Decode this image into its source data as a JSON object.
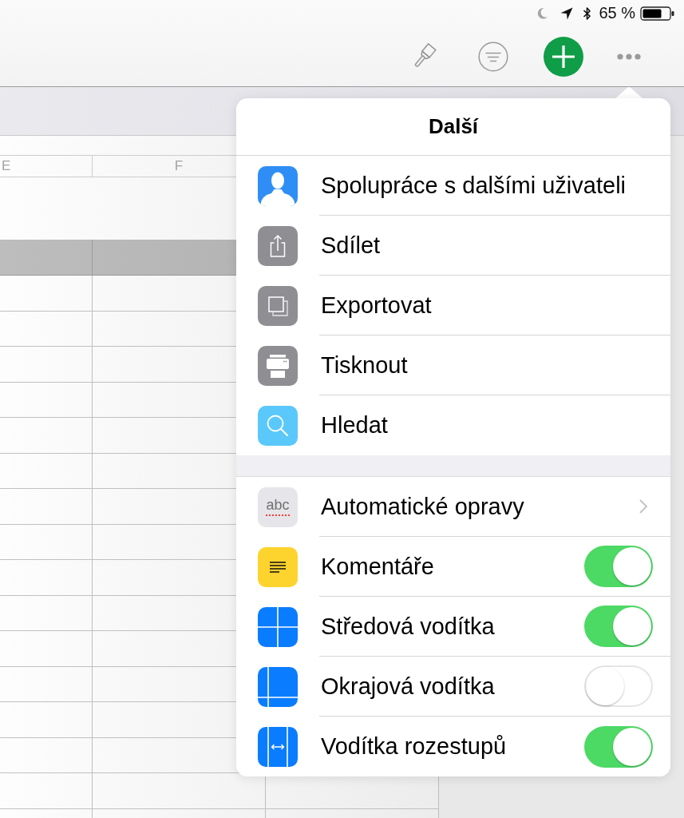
{
  "status_bar": {
    "battery": "65 %"
  },
  "sheet": {
    "columns": [
      "E",
      "F"
    ]
  },
  "popover": {
    "title": "Další",
    "sections": [
      {
        "items": [
          {
            "label": "Spolupráce s dalšími uživateli",
            "kind": "action"
          },
          {
            "label": "Sdílet",
            "kind": "action"
          },
          {
            "label": "Exportovat",
            "kind": "action"
          },
          {
            "label": "Tisknout",
            "kind": "action"
          },
          {
            "label": "Hledat",
            "kind": "action"
          }
        ]
      },
      {
        "items": [
          {
            "label": "Automatické opravy",
            "kind": "disclosure",
            "icon_text": "abc"
          },
          {
            "label": "Komentáře",
            "kind": "toggle",
            "on": true
          },
          {
            "label": "Středová vodítka",
            "kind": "toggle",
            "on": true
          },
          {
            "label": "Okrajová vodítka",
            "kind": "toggle",
            "on": false
          },
          {
            "label": "Vodítka rozestupů",
            "kind": "toggle",
            "on": true
          }
        ]
      }
    ]
  }
}
